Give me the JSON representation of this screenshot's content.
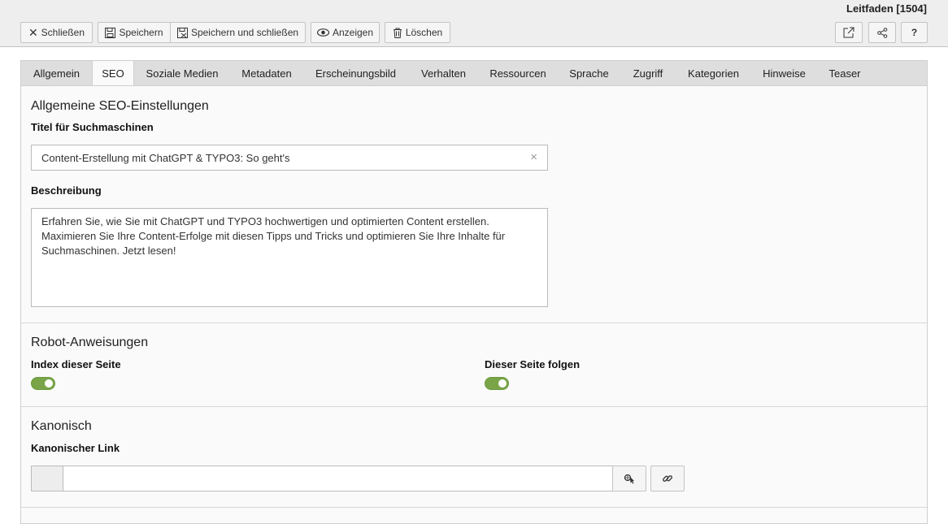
{
  "record_title": "Leitfaden [1504]",
  "toolbar": {
    "close_label": "Schließen",
    "save_label": "Speichern",
    "save_close_label": "Speichern und schließen",
    "view_label": "Anzeigen",
    "delete_label": "Löschen",
    "help_label": "?"
  },
  "tabs": [
    {
      "label": "Allgemein"
    },
    {
      "label": "SEO"
    },
    {
      "label": "Soziale Medien"
    },
    {
      "label": "Metadaten"
    },
    {
      "label": "Erscheinungsbild"
    },
    {
      "label": "Verhalten"
    },
    {
      "label": "Ressourcen"
    },
    {
      "label": "Sprache"
    },
    {
      "label": "Zugriff"
    },
    {
      "label": "Kategorien"
    },
    {
      "label": "Hinweise"
    },
    {
      "label": "Teaser"
    }
  ],
  "active_tab": "SEO",
  "seo": {
    "section_title": "Allgemeine SEO-Einstellungen",
    "title_label": "Titel für Suchmaschinen",
    "title_value": "Content-Erstellung mit ChatGPT & TYPO3: So geht's",
    "clear_icon": "×",
    "description_label": "Beschreibung",
    "description_value": "Erfahren Sie, wie Sie mit ChatGPT und TYPO3 hochwertigen und optimierten Content erstellen.\nMaximieren Sie Ihre Content-Erfolge mit diesen Tipps und Tricks und optimieren Sie Ihre Inhalte für\nSuchmaschinen. Jetzt lesen!"
  },
  "robots": {
    "section_title": "Robot-Anweisungen",
    "index_label": "Index dieser Seite",
    "index_enabled": true,
    "follow_label": "Dieser Seite folgen",
    "follow_enabled": true
  },
  "canonical": {
    "section_title": "Kanonisch",
    "link_label": "Kanonischer Link",
    "link_value": ""
  },
  "colors": {
    "toggle_on": "#79a548",
    "header_bg": "#eeeeee",
    "tab_bar_bg": "#dedede",
    "panel_bg": "#fafafa"
  }
}
